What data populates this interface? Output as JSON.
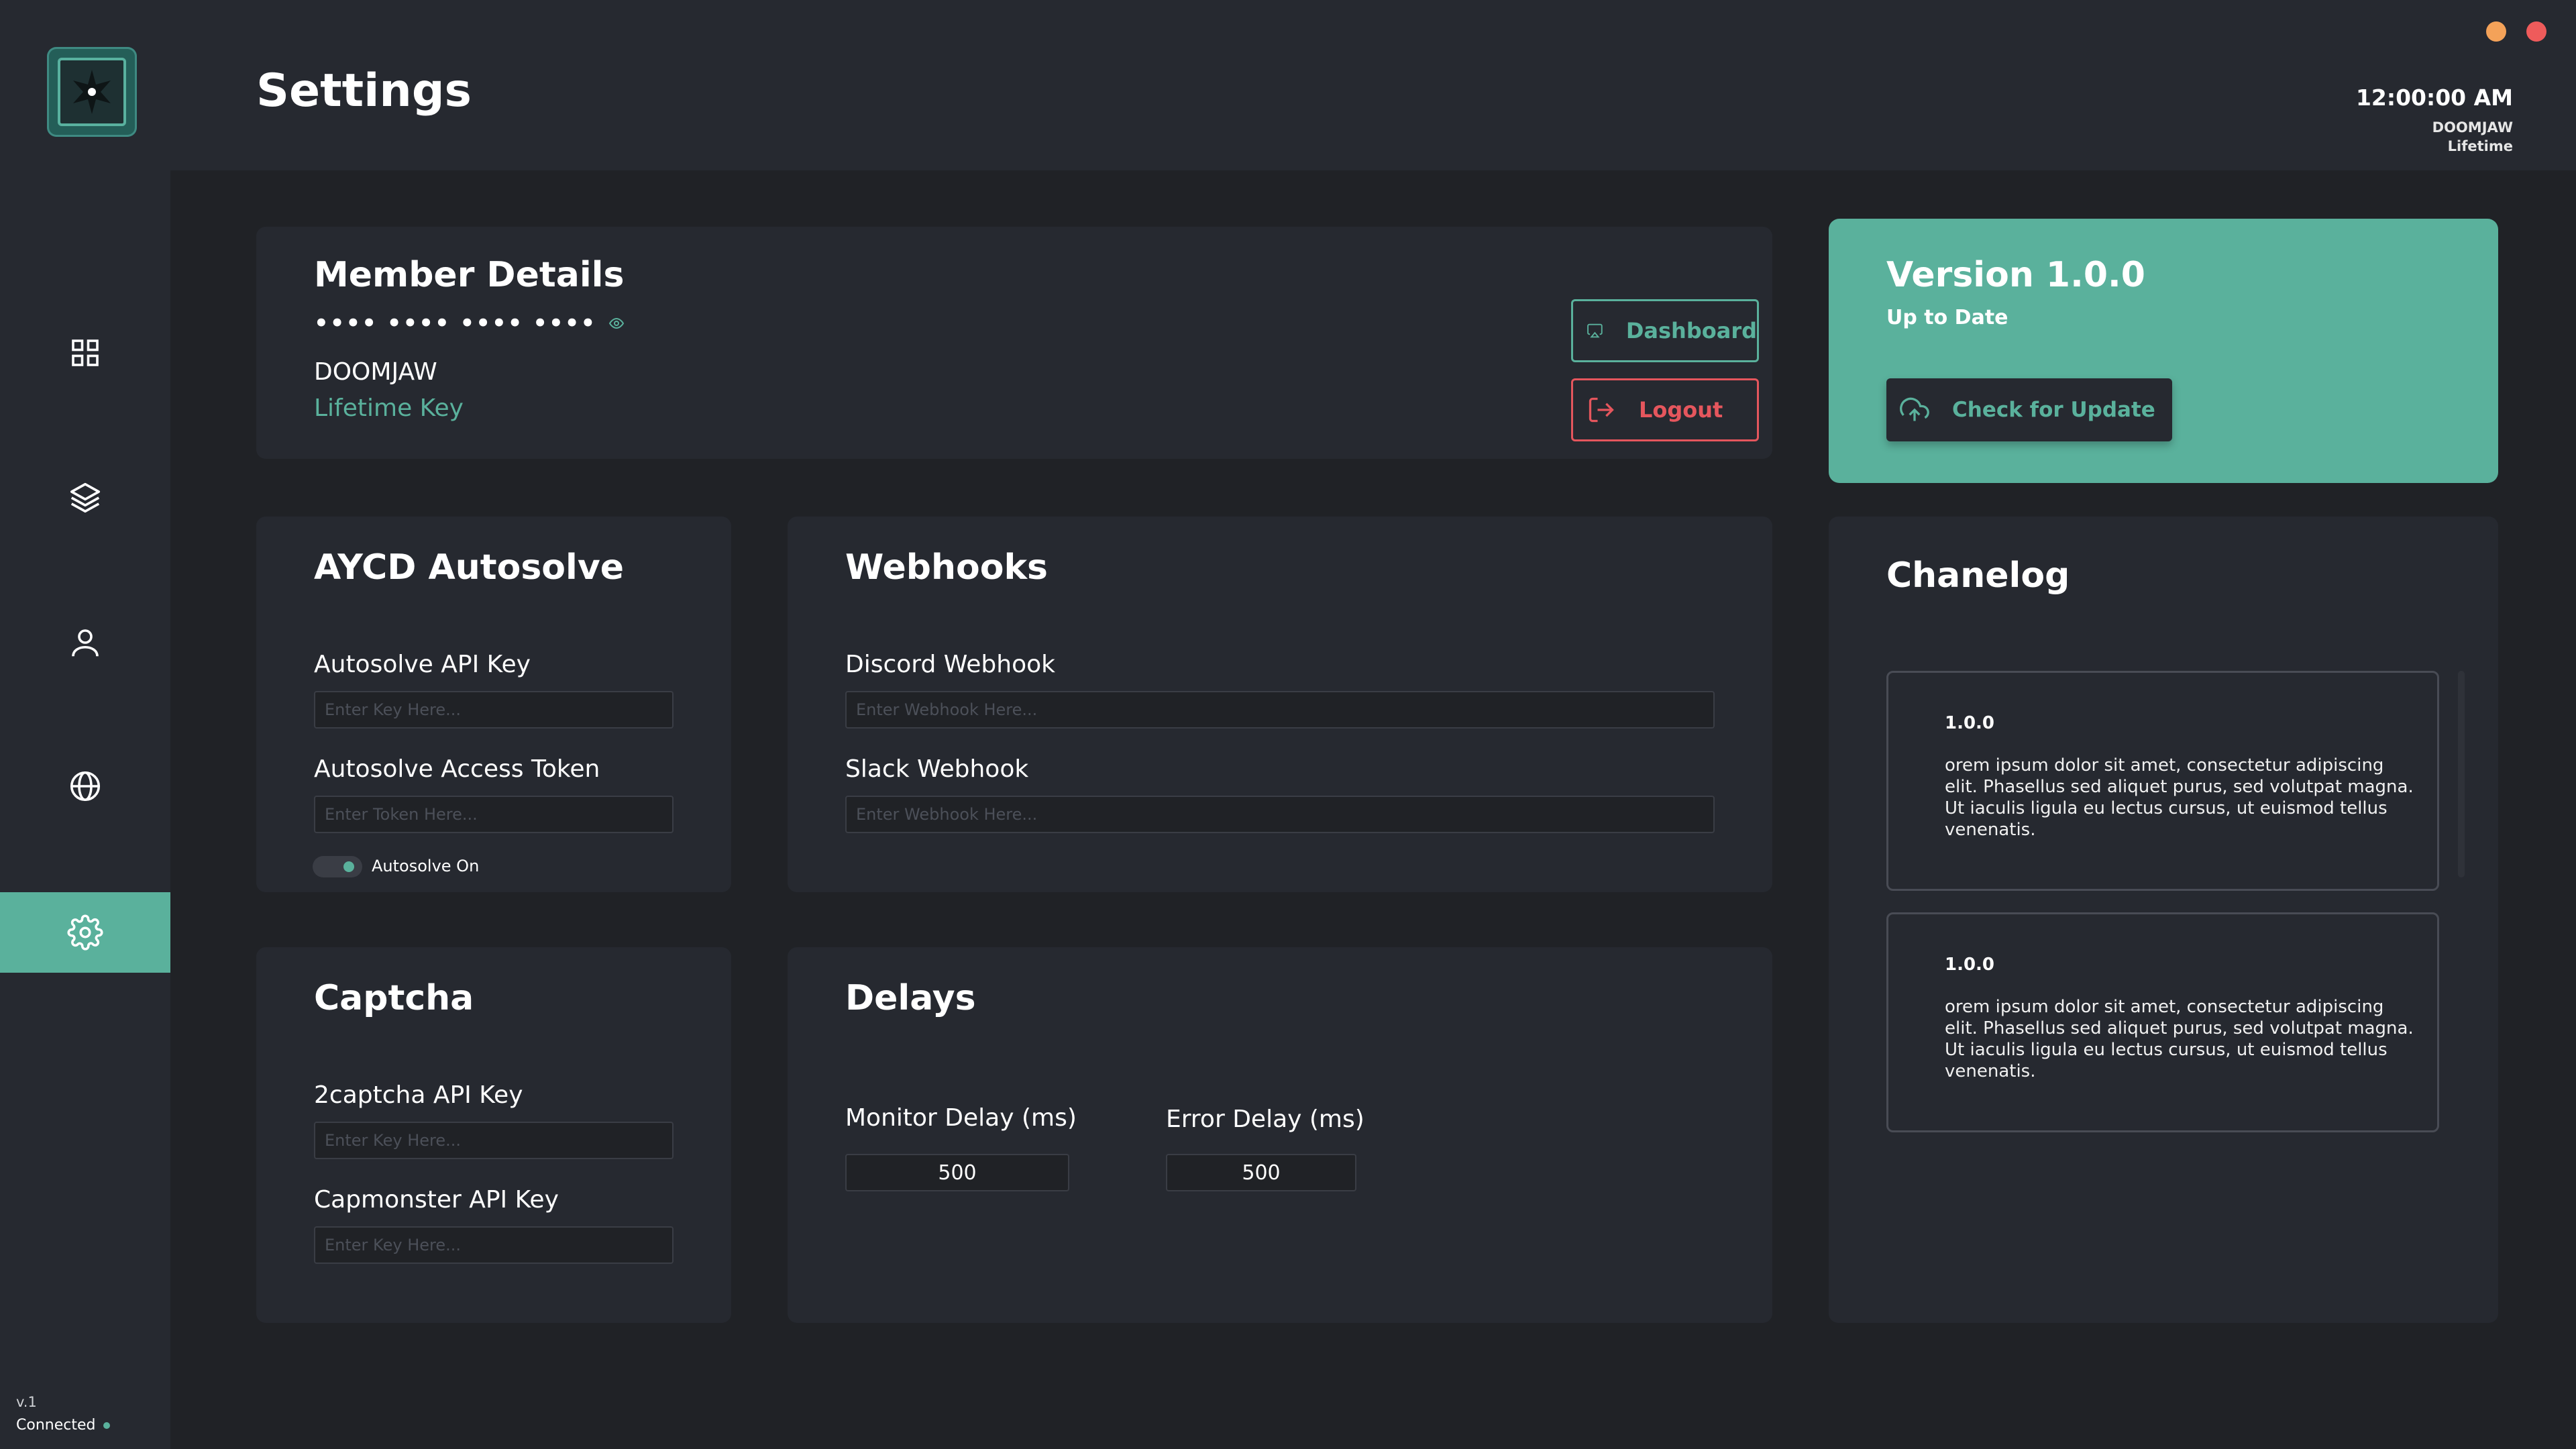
{
  "app": {
    "page_title": "Settings",
    "version_short": "v.1",
    "connection_status": "Connected"
  },
  "header": {
    "time": "12:00:00 AM",
    "username": "DOOMJAW",
    "plan": "Lifetime"
  },
  "colors": {
    "accent": "#5ab19c",
    "danger": "#e5565d",
    "background": "#202226",
    "card": "#262930",
    "minimize": "#f4a259",
    "close": "#ef5b5b"
  },
  "sidebar": {
    "items": [
      {
        "icon": "grid-icon",
        "name": "dashboard"
      },
      {
        "icon": "layers-icon",
        "name": "tasks"
      },
      {
        "icon": "user-icon",
        "name": "profiles"
      },
      {
        "icon": "globe-icon",
        "name": "proxies"
      },
      {
        "icon": "gear-icon",
        "name": "settings",
        "active": true
      }
    ]
  },
  "member": {
    "title": "Member Details",
    "masked_key": "•••• •••• •••• ••••",
    "username": "DOOMJAW",
    "key_type": "Lifetime Key",
    "dashboard_label": "Dashboard",
    "logout_label": "Logout"
  },
  "version_card": {
    "title": "Version 1.0.0",
    "status": "Up to Date",
    "update_label": "Check for Update"
  },
  "autosolve": {
    "title": "AYCD Autosolve",
    "api_key_label": "Autosolve API Key",
    "api_key_placeholder": "Enter Key Here...",
    "token_label": "Autosolve Access Token",
    "token_placeholder": "Enter Token Here...",
    "toggle_label": "Autosolve On"
  },
  "webhooks": {
    "title": "Webhooks",
    "discord_label": "Discord Webhook",
    "discord_placeholder": "Enter Webhook Here...",
    "slack_label": "Slack Webhook",
    "slack_placeholder": "Enter Webhook Here..."
  },
  "captcha": {
    "title": "Captcha",
    "twocaptcha_label": "2captcha API Key",
    "twocaptcha_placeholder": "Enter Key Here...",
    "capmonster_label": "Capmonster API Key",
    "capmonster_placeholder": "Enter Key Here..."
  },
  "delays": {
    "title": "Delays",
    "monitor_label": "Monitor Delay (ms)",
    "monitor_value": "500",
    "error_label": "Error Delay (ms)",
    "error_value": "500"
  },
  "changelog": {
    "title": "Chanelog",
    "entries": [
      {
        "version": "1.0.0",
        "text": "orem ipsum dolor sit amet, consectetur adipiscing elit. Phasellus sed aliquet purus, sed volutpat magna. Ut iaculis ligula eu lectus cursus, ut euismod tellus venenatis."
      },
      {
        "version": "1.0.0",
        "text": "orem ipsum dolor sit amet, consectetur adipiscing elit. Phasellus sed aliquet purus, sed volutpat magna. Ut iaculis ligula eu lectus cursus, ut euismod tellus venenatis."
      }
    ]
  }
}
